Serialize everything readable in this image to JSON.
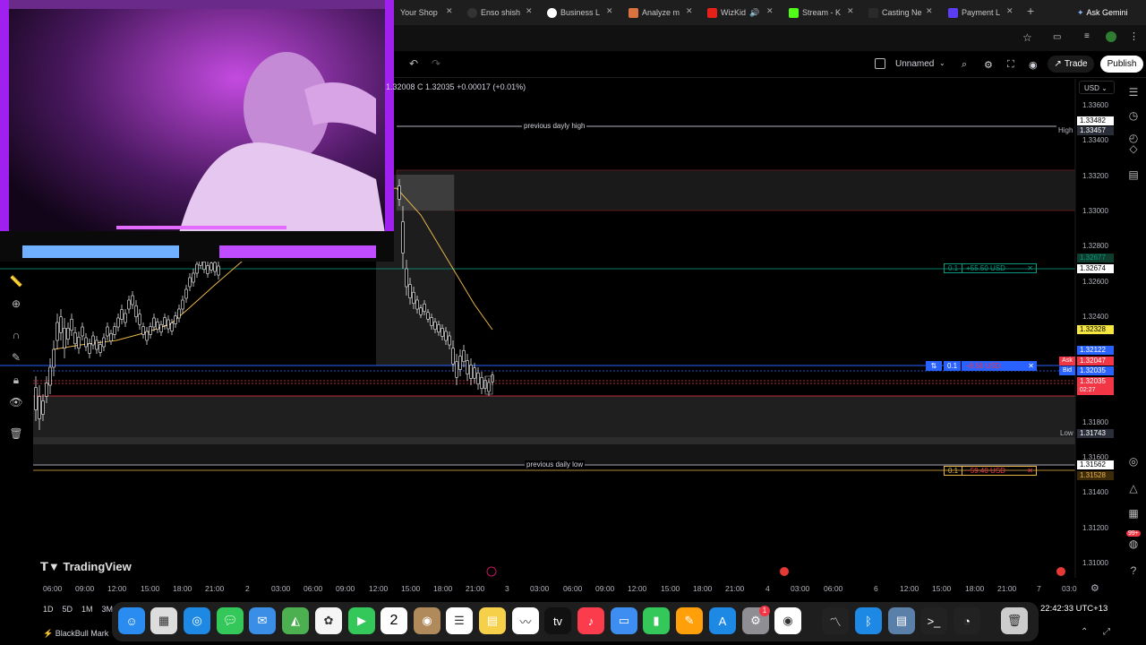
{
  "browser": {
    "tabs": [
      {
        "label": "Your Shop",
        "color": "#444"
      },
      {
        "label": "Enso shish",
        "color": "#333"
      },
      {
        "label": "Business L",
        "color": "#fff"
      },
      {
        "label": "Analyze m",
        "color": "#d9733f"
      },
      {
        "label": "WizKid",
        "color": "#e62117"
      },
      {
        "label": "Stream - K",
        "color": "#53fc18"
      },
      {
        "label": "Casting Ne",
        "color": "#2a2a2a"
      },
      {
        "label": "Payment L",
        "color": "#5a3df5"
      }
    ],
    "new_tab": "+",
    "ask_label": "Ask Gemini"
  },
  "toolbar": {
    "layout_name": "Unnamed",
    "trade_label": "Trade",
    "publish_label": "Publish",
    "currency": "USD"
  },
  "legend": {
    "ohlc": "1.32008 C 1.32035 +0.00017 (+0.01%)"
  },
  "chart": {
    "colors": {
      "up": "#ffffff",
      "down": "#ffffff",
      "ma": "#e8b64b",
      "accent": "#2962ff",
      "red": "#f23645",
      "green": "#089981"
    },
    "price_scale": [
      "1.33600",
      "1.33400",
      "1.33200",
      "1.33000",
      "1.32800",
      "1.32600",
      "1.32400",
      "1.32200",
      "1.32000",
      "1.31800",
      "1.31600",
      "1.31400",
      "1.31200",
      "1.31000"
    ],
    "labels": {
      "prev_high": "previous dayly high",
      "prev_low": "previous daily low",
      "high": "High",
      "low": "Low",
      "ask": "Ask",
      "bid": "Bid"
    },
    "tags": {
      "high1": "1.33482",
      "high2": "1.33457",
      "g1": "1.32677",
      "g2": "1.32674",
      "yellow": "1.32328",
      "blue1": "1.32122",
      "ask": "1.32047",
      "bid": "1.32035",
      "cur": "1.32035",
      "timer": "02:27",
      "low": "1.31743",
      "low1": "1.31562",
      "low2": "1.31528"
    },
    "orders": {
      "tp_qty": "0.1",
      "tp_pnl": "+55.50 USD",
      "entry_qty": "0.1",
      "entry_pnl": "−8.50 USD",
      "sl_qty": "0.1",
      "sl_pnl": "−59.40 USD"
    },
    "time_axis": [
      "06:00",
      "09:00",
      "12:00",
      "15:00",
      "18:00",
      "21:00",
      "2",
      "03:00",
      "06:00",
      "09:00",
      "12:00",
      "15:00",
      "18:00",
      "21:00",
      "3",
      "03:00",
      "06:00",
      "09:00",
      "12:00",
      "15:00",
      "18:00",
      "21:00",
      "4",
      "03:00",
      "06:00",
      "6",
      "12:00",
      "15:00",
      "18:00",
      "21:00",
      "7",
      "03:0"
    ],
    "watermark": "TradingView"
  },
  "timeframes": [
    "1D",
    "5D",
    "1M",
    "3M"
  ],
  "status": {
    "broker": "BlackBull Mark",
    "clock": "22:42:33 UTC+13"
  },
  "dock": {
    "calendar_day": "2",
    "badge": "1"
  }
}
